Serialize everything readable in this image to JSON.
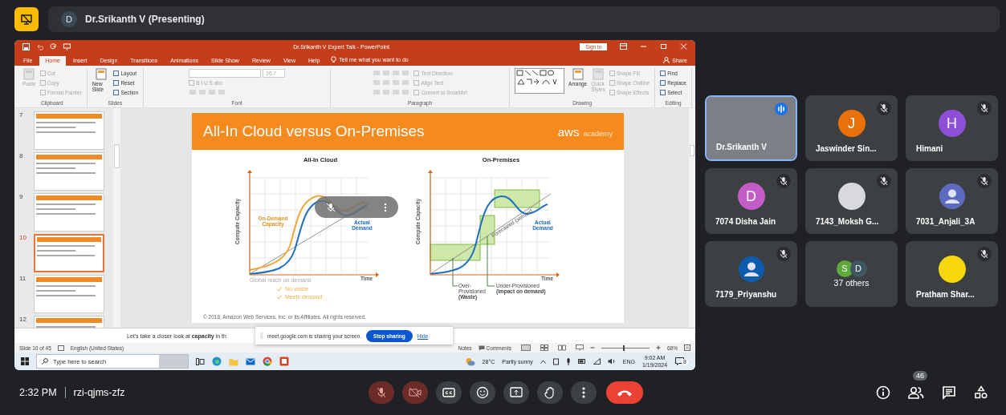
{
  "top_bar": {
    "presenter_initial": "D",
    "presenter_label": "Dr.Srikanth V (Presenting)"
  },
  "shared_screen": {
    "title_bar": {
      "title": "Dr.Srikanth V Expert Talk - PowerPoint",
      "sign_in": "Sign in"
    },
    "ribbon_tabs": [
      {
        "label": "File",
        "selected": false
      },
      {
        "label": "Home",
        "selected": true
      },
      {
        "label": "Insert",
        "selected": false
      },
      {
        "label": "Design",
        "selected": false
      },
      {
        "label": "Transitions",
        "selected": false
      },
      {
        "label": "Animations",
        "selected": false
      },
      {
        "label": "Slide Show",
        "selected": false
      },
      {
        "label": "Review",
        "selected": false
      },
      {
        "label": "View",
        "selected": false
      },
      {
        "label": "Help",
        "selected": false
      }
    ],
    "tell_me": "Tell me what you want to do",
    "share": "Share",
    "ribbon_groups": [
      {
        "label": "Clipboard",
        "items": [
          {
            "kind": "large",
            "label": "Paste",
            "disabled": true
          },
          {
            "kind": "small",
            "label": "Cut",
            "disabled": true
          },
          {
            "kind": "small",
            "label": "Copy",
            "disabled": true
          },
          {
            "kind": "small",
            "label": "Format Painter",
            "disabled": true
          }
        ]
      },
      {
        "label": "Slides",
        "items": [
          {
            "kind": "large",
            "label": "New Slide",
            "disabled": false
          },
          {
            "kind": "small",
            "label": "Layout",
            "disabled": false
          },
          {
            "kind": "small",
            "label": "Reset",
            "disabled": false
          },
          {
            "kind": "small",
            "label": "Section",
            "disabled": false
          }
        ]
      },
      {
        "label": "Font",
        "items": [
          {
            "kind": "combo",
            "label": "26.7",
            "disabled": true
          },
          {
            "kind": "small",
            "label": "B  I  U  S  abc",
            "disabled": true
          },
          {
            "kind": "iconrow",
            "disabled": true
          }
        ]
      },
      {
        "label": "Paragraph",
        "items": [
          {
            "kind": "iconrow",
            "disabled": true
          },
          {
            "kind": "iconrow",
            "disabled": true
          },
          {
            "kind": "iconrow",
            "disabled": true
          },
          {
            "kind": "small",
            "label": "Text Direction",
            "disabled": true
          },
          {
            "kind": "small",
            "label": "Align Text",
            "disabled": true
          },
          {
            "kind": "small",
            "label": "Convert to SmartArt",
            "disabled": true
          }
        ]
      },
      {
        "label": "Drawing",
        "items": [
          {
            "kind": "shapes",
            "disabled": false
          },
          {
            "kind": "large",
            "label": "Arrange",
            "disabled": false
          },
          {
            "kind": "large",
            "label": "Quick Styles",
            "disabled": true
          },
          {
            "kind": "small",
            "label": "Shape Fill",
            "disabled": true
          },
          {
            "kind": "small",
            "label": "Shape Outline",
            "disabled": true
          },
          {
            "kind": "small",
            "label": "Shape Effects",
            "disabled": true
          }
        ]
      },
      {
        "label": "Editing",
        "items": [
          {
            "kind": "small",
            "label": "Find",
            "disabled": false
          },
          {
            "kind": "small",
            "label": "Replace",
            "disabled": false
          },
          {
            "kind": "small",
            "label": "Select",
            "disabled": false
          }
        ]
      }
    ],
    "thumbnails": [
      {
        "number": "7",
        "selected": false
      },
      {
        "number": "8",
        "selected": false
      },
      {
        "number": "9",
        "selected": false
      },
      {
        "number": "10",
        "selected": true
      },
      {
        "number": "11",
        "selected": false
      },
      {
        "number": "12",
        "selected": false
      }
    ],
    "slide": {
      "title": "All-In Cloud versus On-Premises",
      "logo_word": "aws",
      "logo_caption": "academy",
      "panels": [
        {
          "kind": "cloud",
          "heading": "All-In Cloud",
          "y_label": "Compute Capacity",
          "x_label": "Time",
          "capacity_label": "On-Demand Capacity",
          "demand_label": "Actual Demand",
          "notes": [
            "Global reach on demand",
            "No waste",
            "Meets demand"
          ]
        },
        {
          "kind": "premises",
          "heading": "On-Premises",
          "y_label": "Compute Capacity",
          "x_label": "Time",
          "forecast_label": "Forecasted Demand",
          "demand_label": "Actual Demand",
          "callouts": [
            "Over-Provisioned **(Waste)**",
            "Under-Provisioned **(Impact on demand)**"
          ]
        }
      ],
      "copyright": "© 2018, Amazon Web Services, Inc. or its Affiliates. All rights reserved."
    },
    "notes_text": "Let's take a closer look at **capacity** in th",
    "share_banner": {
      "message": "meet.google.com is sharing your screen.",
      "stop": "Stop sharing",
      "hide": "Hide"
    },
    "status_bar": {
      "slide_count": "Slide 10 of 45",
      "language": "English (United States)",
      "notes": "Notes",
      "comments": "Comments",
      "zoom": {
        "level": 0.45,
        "label": "68%"
      }
    },
    "taskbar": {
      "search_placeholder": "Type here to search",
      "temperature": "28°C",
      "weather": "Partly sunny",
      "language": "ENG",
      "time": "9:02 AM",
      "date": "1/19/2024",
      "notifications": "8"
    }
  },
  "participants": [
    {
      "kind": "video",
      "name": "Dr.Srikanth V",
      "speaking": true,
      "muted": false
    },
    {
      "kind": "letter",
      "name": "Jaswinder Sin...",
      "initial": "J",
      "color": "#e8710a",
      "speaking": false,
      "muted": true
    },
    {
      "kind": "letter",
      "name": "Himani",
      "initial": "H",
      "color": "#8e4fd8",
      "speaking": false,
      "muted": true
    },
    {
      "kind": "letter",
      "name": "7074 Disha Jain",
      "initial": "D",
      "color": "#c35cc6",
      "speaking": false,
      "muted": true
    },
    {
      "kind": "photo",
      "name": "7143_Moksh G...",
      "speaking": false,
      "muted": true
    },
    {
      "kind": "silhouette",
      "name": "7031_Anjali_3A",
      "color": "#5c6bc0",
      "speaking": false,
      "muted": true
    },
    {
      "kind": "silhouette",
      "name": "7179_Priyanshu",
      "color": "#0b5cad",
      "speaking": false,
      "muted": true
    },
    {
      "kind": "others",
      "label": "37 others",
      "initials": [
        {
          "letter": "S",
          "color": "#5fa83c"
        },
        {
          "letter": "D",
          "color": "#3f5663"
        }
      ]
    },
    {
      "kind": "plain",
      "name": "Pratham Shar...",
      "color": "#f6d70a",
      "speaking": false,
      "muted": true
    }
  ],
  "bottom_bar": {
    "time": "2:32 PM",
    "meeting_code": "rzi-qjms-zfz",
    "controls": [
      {
        "kind": "mic",
        "on": false
      },
      {
        "kind": "camera",
        "on": false
      },
      {
        "kind": "captions"
      },
      {
        "kind": "emoji"
      },
      {
        "kind": "present"
      },
      {
        "kind": "hand"
      },
      {
        "kind": "more"
      },
      {
        "kind": "end"
      }
    ],
    "people_count": "46"
  }
}
